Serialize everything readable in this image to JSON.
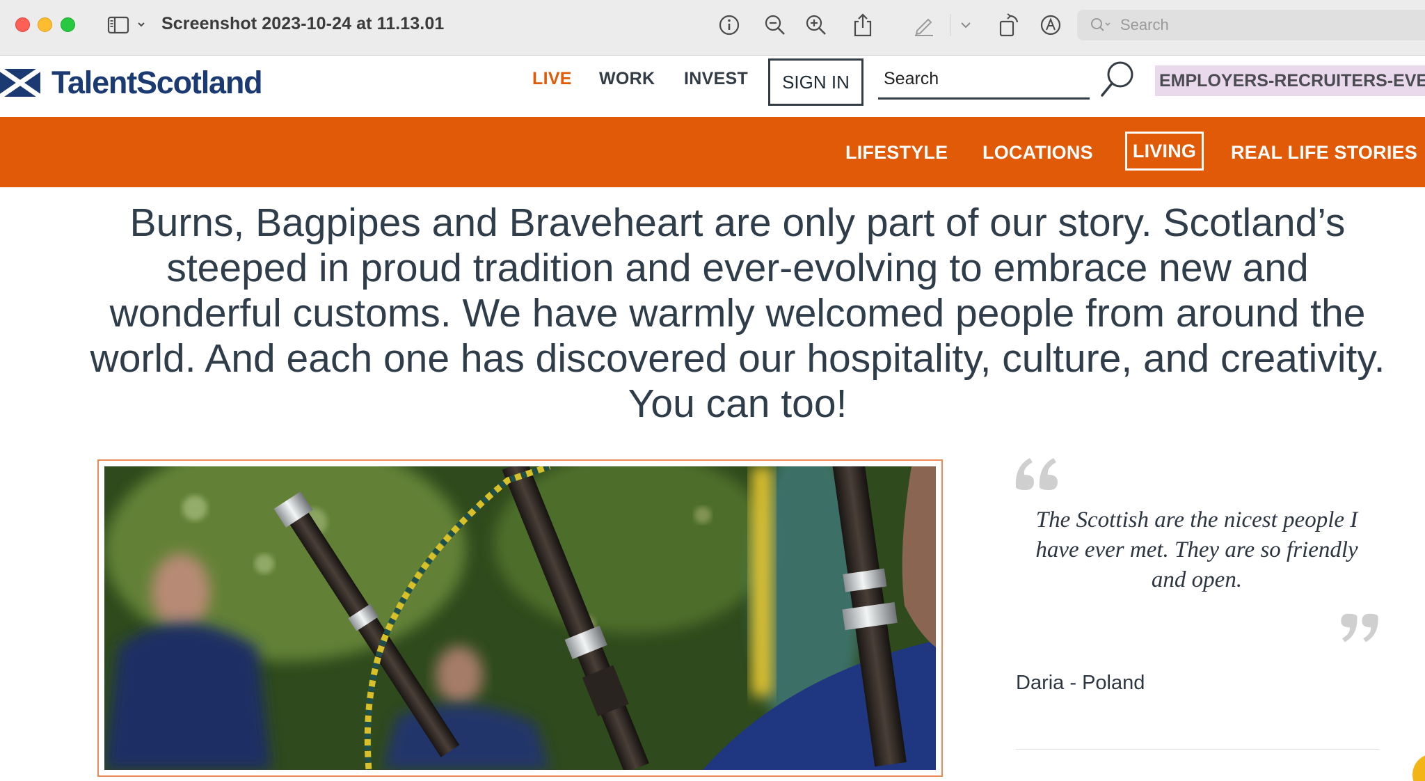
{
  "window": {
    "title": "Screenshot 2023-10-24 at 11.13.01",
    "search_placeholder": "Search"
  },
  "site": {
    "logo_text": "TalentScotland",
    "nav": {
      "live": "LIVE",
      "work": "WORK",
      "invest": "INVEST"
    },
    "sign_in": "SIGN IN",
    "search_value": "Search",
    "employers_link": "EMPLOYERS-RECRUITERS-EVENTS"
  },
  "subnav": {
    "items": [
      "LIFESTYLE",
      "LOCATIONS",
      "LIVING",
      "REAL LIFE STORIES"
    ],
    "active": "LIVING"
  },
  "intro": {
    "text": "Burns, Bagpipes and Braveheart are only part of our story. Scotland’s steeped in proud tradition and ever-evolving to embrace new and wonderful customs. We have warmly welcomed people from around the world. And each one has discovered our hospitality, culture, and creativity. You can too!"
  },
  "quote": {
    "text": "The Scottish are the nicest people I have ever met. They are so friendly and open.",
    "author": "Daria - Poland"
  },
  "colors": {
    "brand_orange": "#e05a07",
    "brand_navy": "#1b3a72",
    "text_dark": "#2f3d4a"
  },
  "icons": {
    "sidebar": "sidebar-toggle-icon",
    "info": "info-icon",
    "zoom_out": "zoom-out-icon",
    "zoom_in": "zoom-in-icon",
    "share": "share-icon",
    "markup": "pencil-icon",
    "rotate": "rotate-icon",
    "annotate": "markup-circle-icon",
    "site_search": "magnifier-icon"
  }
}
